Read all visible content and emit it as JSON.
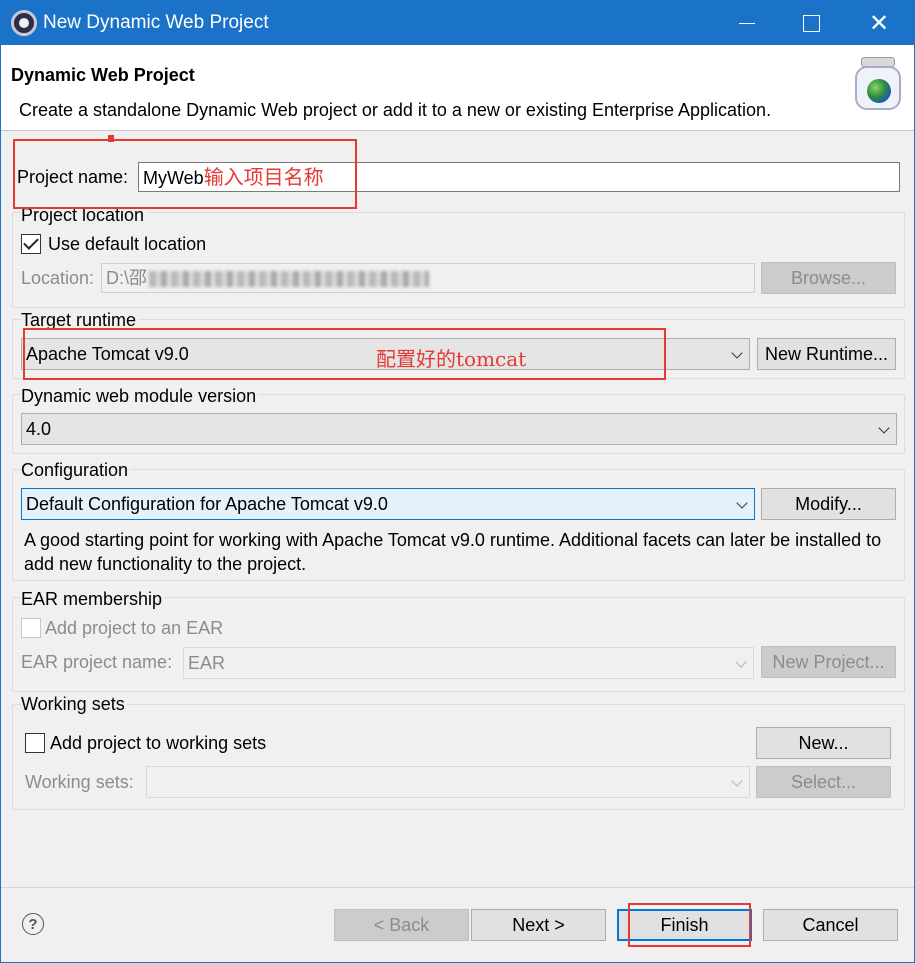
{
  "window": {
    "title": "New Dynamic Web Project"
  },
  "header": {
    "title": "Dynamic Web Project",
    "description": "Create a standalone Dynamic Web project or add it to a new or existing Enterprise Application."
  },
  "project_name": {
    "label": "Project name:",
    "value": "MyWeb"
  },
  "project_location": {
    "group_label": "Project location",
    "use_default_label": "Use default location",
    "use_default_checked": true,
    "location_label": "Location:",
    "location_value": "D:\\邵",
    "browse_label": "Browse..."
  },
  "target_runtime": {
    "group_label": "Target runtime",
    "selected": "Apache Tomcat v9.0",
    "new_runtime_label": "New Runtime..."
  },
  "module_version": {
    "group_label": "Dynamic web module version",
    "selected": "4.0"
  },
  "configuration": {
    "group_label": "Configuration",
    "selected": "Default Configuration for Apache Tomcat v9.0",
    "modify_label": "Modify...",
    "description": "A good starting point for working with Apache Tomcat v9.0 runtime. Additional facets can later be installed to add new functionality to the project."
  },
  "ear": {
    "group_label": "EAR membership",
    "add_label": "Add project to an EAR",
    "project_name_label": "EAR project name:",
    "project_name_value": "EAR",
    "new_project_label": "New Project..."
  },
  "working_sets": {
    "group_label": "Working sets",
    "add_label": "Add project to working sets",
    "new_label": "New...",
    "sets_label": "Working sets:",
    "select_label": "Select..."
  },
  "footer": {
    "back_label": "< Back",
    "next_label": "Next >",
    "finish_label": "Finish",
    "cancel_label": "Cancel"
  },
  "annotations": {
    "project_name_note": "输入项目名称",
    "runtime_note": "配置好的tomcat"
  },
  "colors": {
    "title_bar": "#1a73c8",
    "annotation": "#e53935"
  }
}
